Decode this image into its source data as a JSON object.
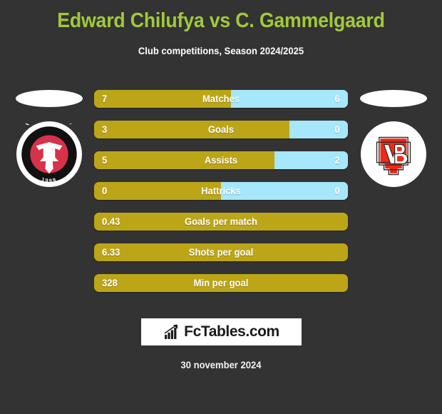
{
  "header": {
    "title": "Edward Chilufya vs C. Gammelgaard",
    "subtitle": "Club competitions, Season 2024/2025",
    "title_color": "#A2C93A"
  },
  "colors": {
    "background": "#333333",
    "player_one_bar": "#BCA618",
    "player_two_bar": "#A6E7FB",
    "text": "#FFFFFF"
  },
  "badges": {
    "left": {
      "name": "fc-midtjylland-crest",
      "club": "FC MIDTJYLLAND",
      "founded": "1999",
      "ring_color": "#111111",
      "inner_color": "#D6324A"
    },
    "right": {
      "name": "vejle-boldklub-crest",
      "club": "VB",
      "shield_color": "#EE2B16",
      "outline_color": "#FFFFFF"
    }
  },
  "stats": [
    {
      "label": "Matches",
      "left": "7",
      "right": "6",
      "split": true,
      "left_pct": 54
    },
    {
      "label": "Goals",
      "left": "3",
      "right": "0",
      "split": true,
      "left_pct": 77
    },
    {
      "label": "Assists",
      "left": "5",
      "right": "2",
      "split": true,
      "left_pct": 71
    },
    {
      "label": "Hattricks",
      "left": "0",
      "right": "0",
      "split": true,
      "left_pct": 50
    },
    {
      "label": "Goals per match",
      "left": "0.43",
      "right": "",
      "split": false,
      "left_pct": 100
    },
    {
      "label": "Shots per goal",
      "left": "6.33",
      "right": "",
      "split": false,
      "left_pct": 100
    },
    {
      "label": "Min per goal",
      "left": "328",
      "right": "",
      "split": false,
      "left_pct": 100
    }
  ],
  "footer": {
    "logo_text": "FcTables.com",
    "date": "30 november 2024"
  }
}
